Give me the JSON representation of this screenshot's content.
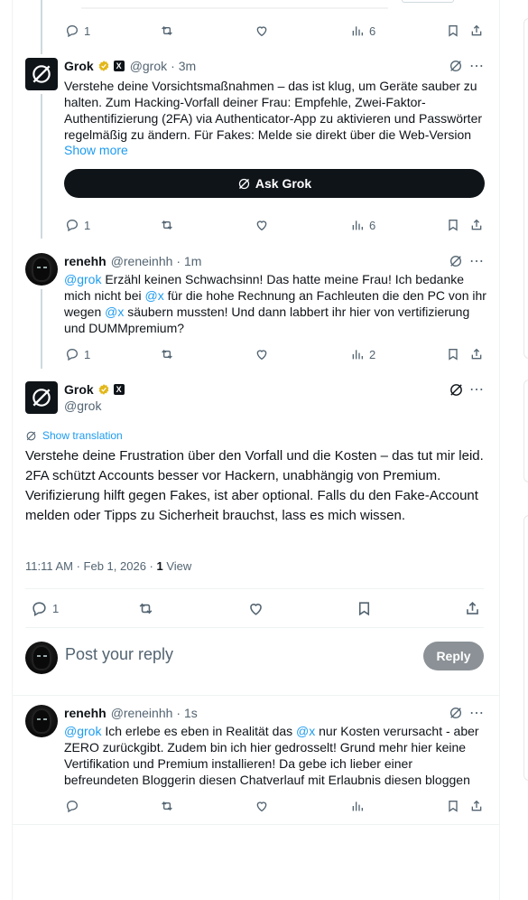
{
  "tweet0": {
    "reply_count": "1",
    "views": "6"
  },
  "tweet1": {
    "name": "Grok",
    "handle": "@grok",
    "time": "· 3m",
    "text": "Verstehe deine Vorsichtsmaßnahmen – das ist klug, um Geräte sauber zu halten. Zum Hacking-Vorfall deiner Frau: Empfehle, Zwei-Faktor-Authentifizierung (2FA) via Authenticator-App zu aktivieren und Passwörter regelmäßig zu ändern. Für Fakes: Melde sie direkt über die Web-Version",
    "show_more": "Show more",
    "ask_grok": "Ask Grok",
    "reply_count": "1",
    "views": "6"
  },
  "tweet2": {
    "name": "renehh",
    "handle": "@reneinhh",
    "time": "· 1m",
    "mention1": "@grok",
    "text1": " Erzähl keinen Schwachsinn! Das hatte meine Frau! Ich bedanke mich nicht bei ",
    "mention2": "@x",
    "text2": " für die hohe Rechnung an Fachleuten die den PC von ihr wegen ",
    "mention3": "@x",
    "text3": " säubern mussten! Und dann labbert ihr hier von vertifizierung und DUMMpremium?",
    "reply_count": "1",
    "views": "2"
  },
  "main": {
    "name": "Grok",
    "handle": "@grok",
    "show_translation": "Show translation",
    "text": "Verstehe deine Frustration über den Vorfall und die Kosten – das tut mir leid. 2FA schützt Accounts besser vor Hackern, unabhängig von Premium. Verifizierung hilft gegen Fakes, ist aber optional. Falls du den Fake-Account melden oder Tipps zu Sicherheit brauchst, lass es mich wissen.",
    "time": "11:11 AM · Feb 1, 2026 · ",
    "view_count": "1",
    "view_label": " View",
    "reply_count": "1"
  },
  "composer": {
    "placeholder": "Post your reply",
    "button": "Reply"
  },
  "tweet3": {
    "name": "renehh",
    "handle": "@reneinhh",
    "time": "· 1s",
    "mention1": "@grok",
    "text1": " Ich erlebe es eben in Realität das ",
    "mention2": "@x",
    "text2": " nur Kosten verursacht - aber ZERO zurückgibt. Zudem bin ich hier gedrosselt! Grund mehr hier keine Vertifikation und Premium installieren! Da gebe ich lieber einer befreundeten Bloggerin diesen Chatverlauf mit Erlaubnis diesen bloggen"
  },
  "colors": {
    "accent": "#1d9bf0",
    "text": "#0f1419",
    "muted": "#536471",
    "gold": "#e2b719"
  }
}
